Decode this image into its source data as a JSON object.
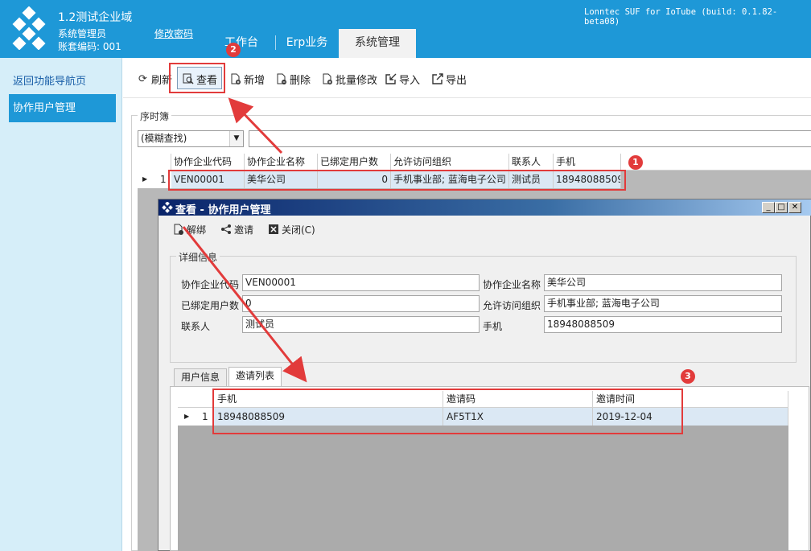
{
  "header": {
    "app_title": "1.2测试企业域",
    "user_role": "系统管理员",
    "account_no": "账套编码: 001",
    "change_password": "修改密码",
    "build_info": "Lonntec SUF for IoTube (build: 0.1.82-beta08)",
    "tabs": [
      {
        "label": "工作台",
        "active": false
      },
      {
        "label": "Erp业务",
        "active": false
      },
      {
        "label": "系统管理",
        "active": true
      }
    ]
  },
  "sidebar": {
    "back_label": "返回功能导航页",
    "items": [
      {
        "label": "协作用户管理",
        "active": true
      }
    ]
  },
  "toolbar": {
    "buttons": [
      {
        "label": "刷新",
        "icon": "refresh-icon"
      },
      {
        "label": "查看",
        "icon": "view-icon"
      },
      {
        "label": "新增",
        "icon": "add-icon"
      },
      {
        "label": "删除",
        "icon": "delete-icon"
      },
      {
        "label": "批量修改",
        "icon": "batch-edit-icon"
      },
      {
        "label": "导入",
        "icon": "import-icon"
      },
      {
        "label": "导出",
        "icon": "export-icon"
      }
    ]
  },
  "main": {
    "group_label": "序时簿",
    "search_mode": "(模糊查找)",
    "grid": {
      "columns": [
        "协作企业代码",
        "协作企业名称",
        "已绑定用户数",
        "允许访问组织",
        "联系人",
        "手机"
      ],
      "rows": [
        {
          "index": "1",
          "cells": [
            "VEN00001",
            "美华公司",
            "0",
            "手机事业部; 蓝海电子公司",
            "测试员",
            "18948088509"
          ]
        }
      ]
    }
  },
  "dialog": {
    "title": "查看 - 协作用户管理",
    "toolbar": [
      {
        "label": "解绑",
        "icon": "unbind-icon"
      },
      {
        "label": "邀请",
        "icon": "share-icon"
      },
      {
        "label": "关闭(C)",
        "icon": "close-box-icon"
      }
    ],
    "detail_label": "详细信息",
    "fields": [
      {
        "label": "协作企业代码",
        "value": "VEN00001"
      },
      {
        "label": "协作企业名称",
        "value": "美华公司"
      },
      {
        "label": "已绑定用户数",
        "value": "0"
      },
      {
        "label": "允许访问组织",
        "value": "手机事业部; 蓝海电子公司"
      },
      {
        "label": "联系人",
        "value": "测试员"
      },
      {
        "label": "手机",
        "value": "18948088509"
      }
    ],
    "tabs": [
      {
        "label": "用户信息",
        "active": false
      },
      {
        "label": "邀请列表",
        "active": true
      }
    ],
    "invite_grid": {
      "columns": [
        "手机",
        "邀请码",
        "邀请时间"
      ],
      "rows": [
        {
          "index": "1",
          "cells": [
            "18948088509",
            "AF5T1X",
            "2019-12-04"
          ]
        }
      ]
    }
  },
  "annotations": {
    "badges": [
      "1",
      "2",
      "3"
    ],
    "color": "#e23b3b"
  },
  "colors": {
    "header_bg": "#1e98d7",
    "sidebar_bg": "#d6eef9",
    "selected_row": "#dbe8f4"
  }
}
